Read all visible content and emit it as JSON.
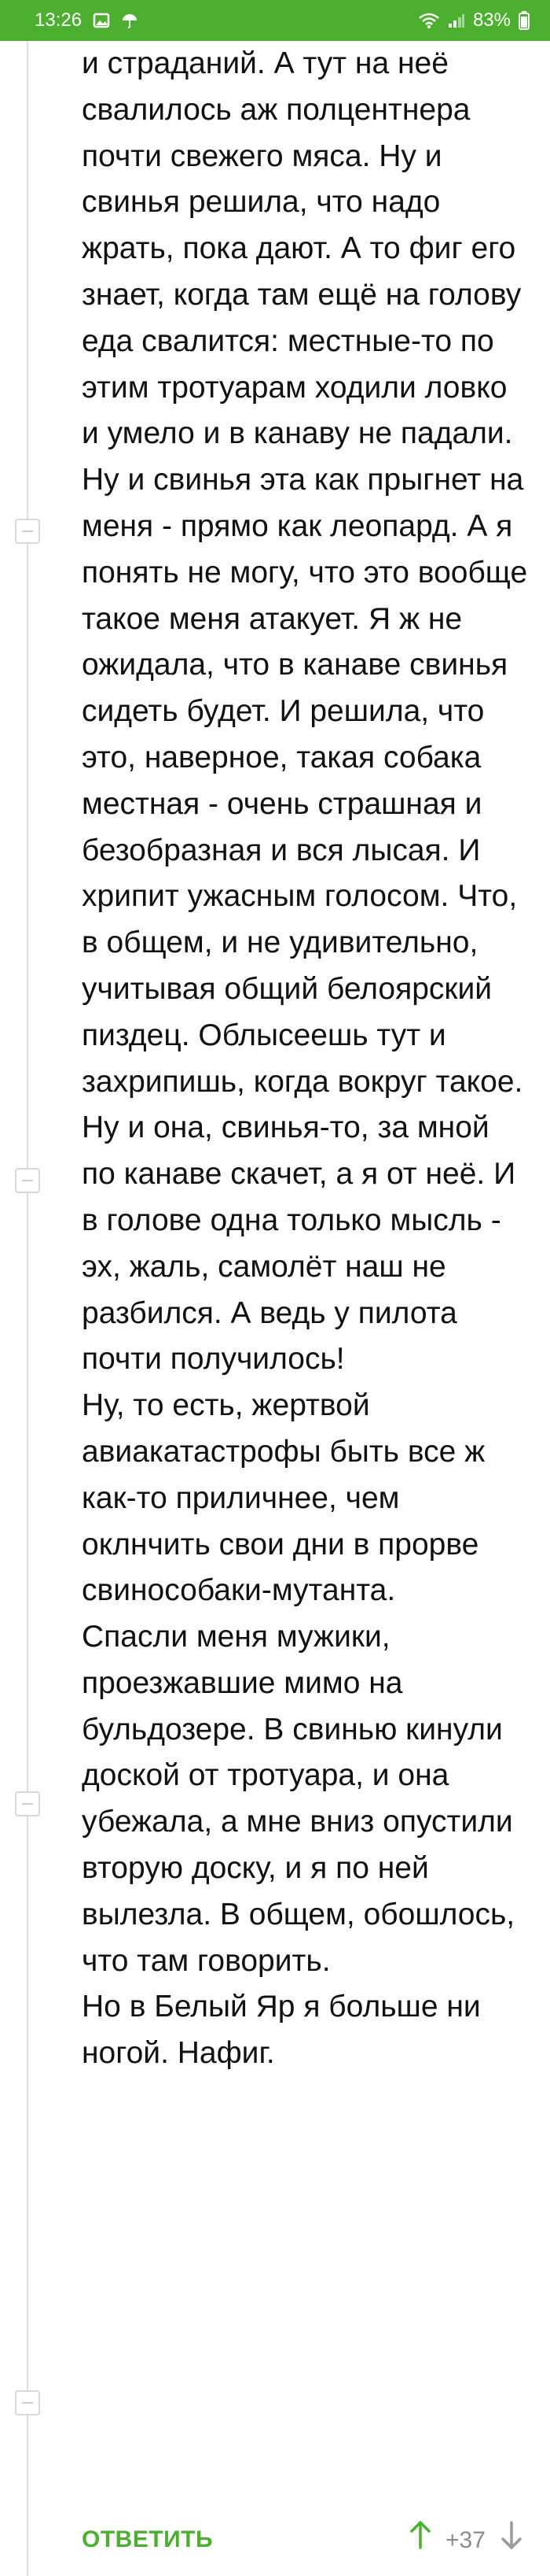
{
  "status_bar": {
    "time": "13:26",
    "battery": "83%",
    "left_icons": [
      "gallery-icon",
      "umbrella-icon"
    ],
    "right_icons": [
      "wifi-icon",
      "signal-icon",
      "battery-icon"
    ]
  },
  "comment": {
    "paragraphs": [
      "и страданий. А тут на неё свалилось аж полцентнера почти свежего мяса. Ну и свинья решила, что надо жрать, пока дают. А то фиг его знает, когда там ещё на голову еда свалится: местные-то по этим тротуарам ходили ловко и умело и в канаву не падали.",
      "Ну и свинья эта как прыгнет на меня - прямо как леопард. А я понять не могу, что это вообще такое меня атакует. Я ж не ожидала, что в канаве свинья сидеть будет. И решила, что это, наверное, такая собака местная - очень страшная и безобразная и вся лысая. И хрипит ужасным голосом. Что, в общем, и не удивительно, учитывая общий белоярский пиздец. Облысеешь тут и захрипишь, когда вокруг такое.",
      "Ну и она, свинья-то, за мной по канаве скачет, а я от неё. И в голове одна только мысль - эх, жаль, самолёт наш не разбился. А ведь у пилота почти получилось!",
      "Ну, то есть, жертвой авиакатастрофы быть все ж как-то приличнее, чем оклнчить свои дни в прорве свинособаки-мутанта.",
      "Спасли меня мужики, проезжавшие мимо на бульдозере. В свинью кинули доской от тротуара, и она убежала, а мне вниз опустили вторую доску, и я по ней вылезла. В общем, обошлось, что там говорить.",
      "Но в Белый Яр я больше ни ногой. Нафиг."
    ]
  },
  "footer": {
    "reply_label": "ОТВЕТИТЬ",
    "rating": "+37"
  },
  "colors": {
    "accent": "#4caf30",
    "text": "#111111",
    "muted": "#8c8c8c",
    "thread_line": "#dedede"
  }
}
